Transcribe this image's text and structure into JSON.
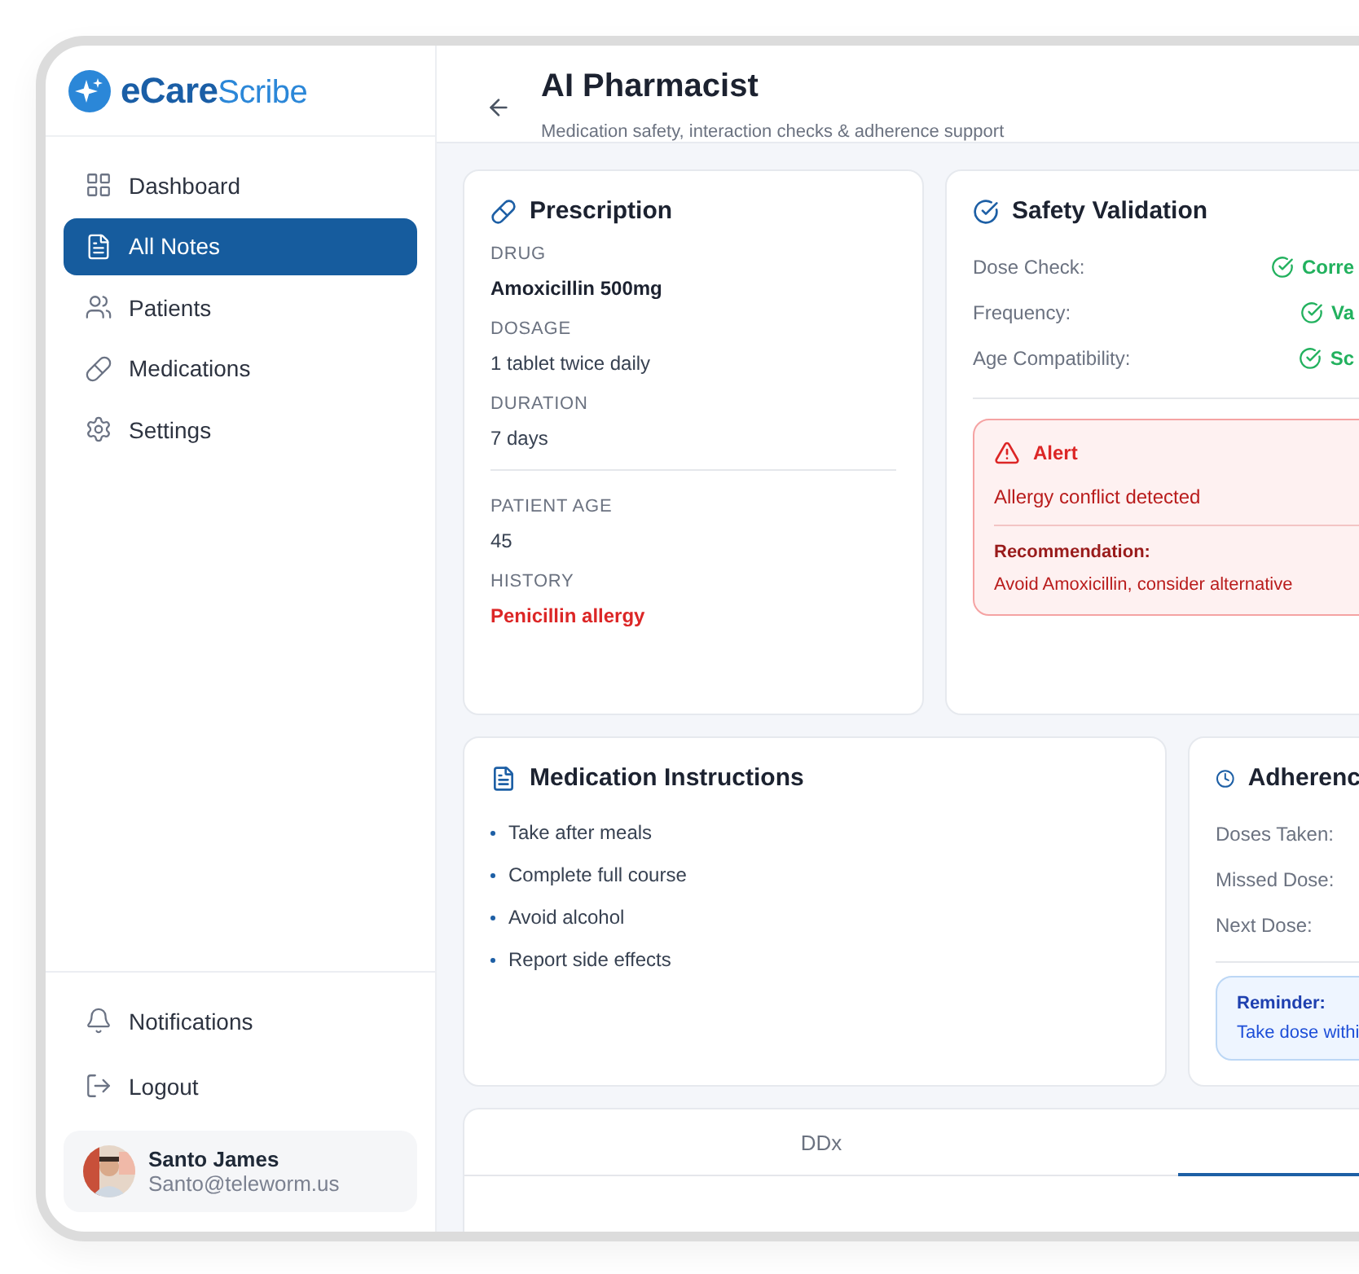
{
  "sidebar": {
    "logo": {
      "bold": "eCare",
      "light": "Scribe"
    },
    "nav": [
      {
        "label": "Dashboard",
        "kind": "grid",
        "selected": false
      },
      {
        "label": "All Notes",
        "kind": "note",
        "selected": true
      },
      {
        "label": "Patients",
        "kind": "users",
        "selected": false
      },
      {
        "label": "Medications",
        "kind": "pill",
        "selected": false
      },
      {
        "label": "Settings",
        "kind": "gear",
        "selected": false
      }
    ],
    "footer": [
      {
        "label": "Notifications",
        "kind": "bell"
      },
      {
        "label": "Logout",
        "kind": "logout"
      }
    ],
    "user": {
      "name": "Santo James",
      "email": "Santo@teleworm.us"
    }
  },
  "header": {
    "title": "AI Pharmacist",
    "subtitle": "Medication safety, interaction checks & adherence support"
  },
  "prescription": {
    "title": "Prescription",
    "groups": [
      [
        {
          "label": "DRUG",
          "value": "Amoxicillin 500mg",
          "kind": "strong"
        },
        {
          "label": "DOSAGE",
          "value": "1 tablet twice daily",
          "kind": "plain"
        },
        {
          "label": "DURATION",
          "value": "7 days",
          "kind": "plain"
        }
      ],
      [
        {
          "label": "PATIENT AGE",
          "value": "45",
          "kind": "plain"
        },
        {
          "label": "HISTORY",
          "value": "Penicillin allergy",
          "kind": "warning"
        }
      ]
    ]
  },
  "safety": {
    "title": "Safety Validation",
    "checks": [
      {
        "label": "Dose Check:",
        "value": "Corre"
      },
      {
        "label": "Frequency:",
        "value": "Va"
      },
      {
        "label": "Age Compatibility:",
        "value": "Sc"
      }
    ],
    "alert": {
      "title": "Alert",
      "message": "Allergy conflict detected",
      "recommendation_label": "Recommendation:",
      "recommendation": "Avoid Amoxicillin, consider alternative"
    }
  },
  "instructions": {
    "title": "Medication Instructions",
    "items": [
      "Take after meals",
      "Complete full course",
      "Avoid alcohol",
      "Report side effects"
    ]
  },
  "adherence": {
    "title": "Adherenc",
    "rows": [
      "Doses Taken:",
      "Missed Dose:",
      "Next Dose:"
    ],
    "reminder": {
      "title": "Reminder:",
      "text": "Take dose withi"
    }
  },
  "tabs": [
    {
      "label": "DDx",
      "selected": false
    },
    {
      "selected": true
    }
  ]
}
